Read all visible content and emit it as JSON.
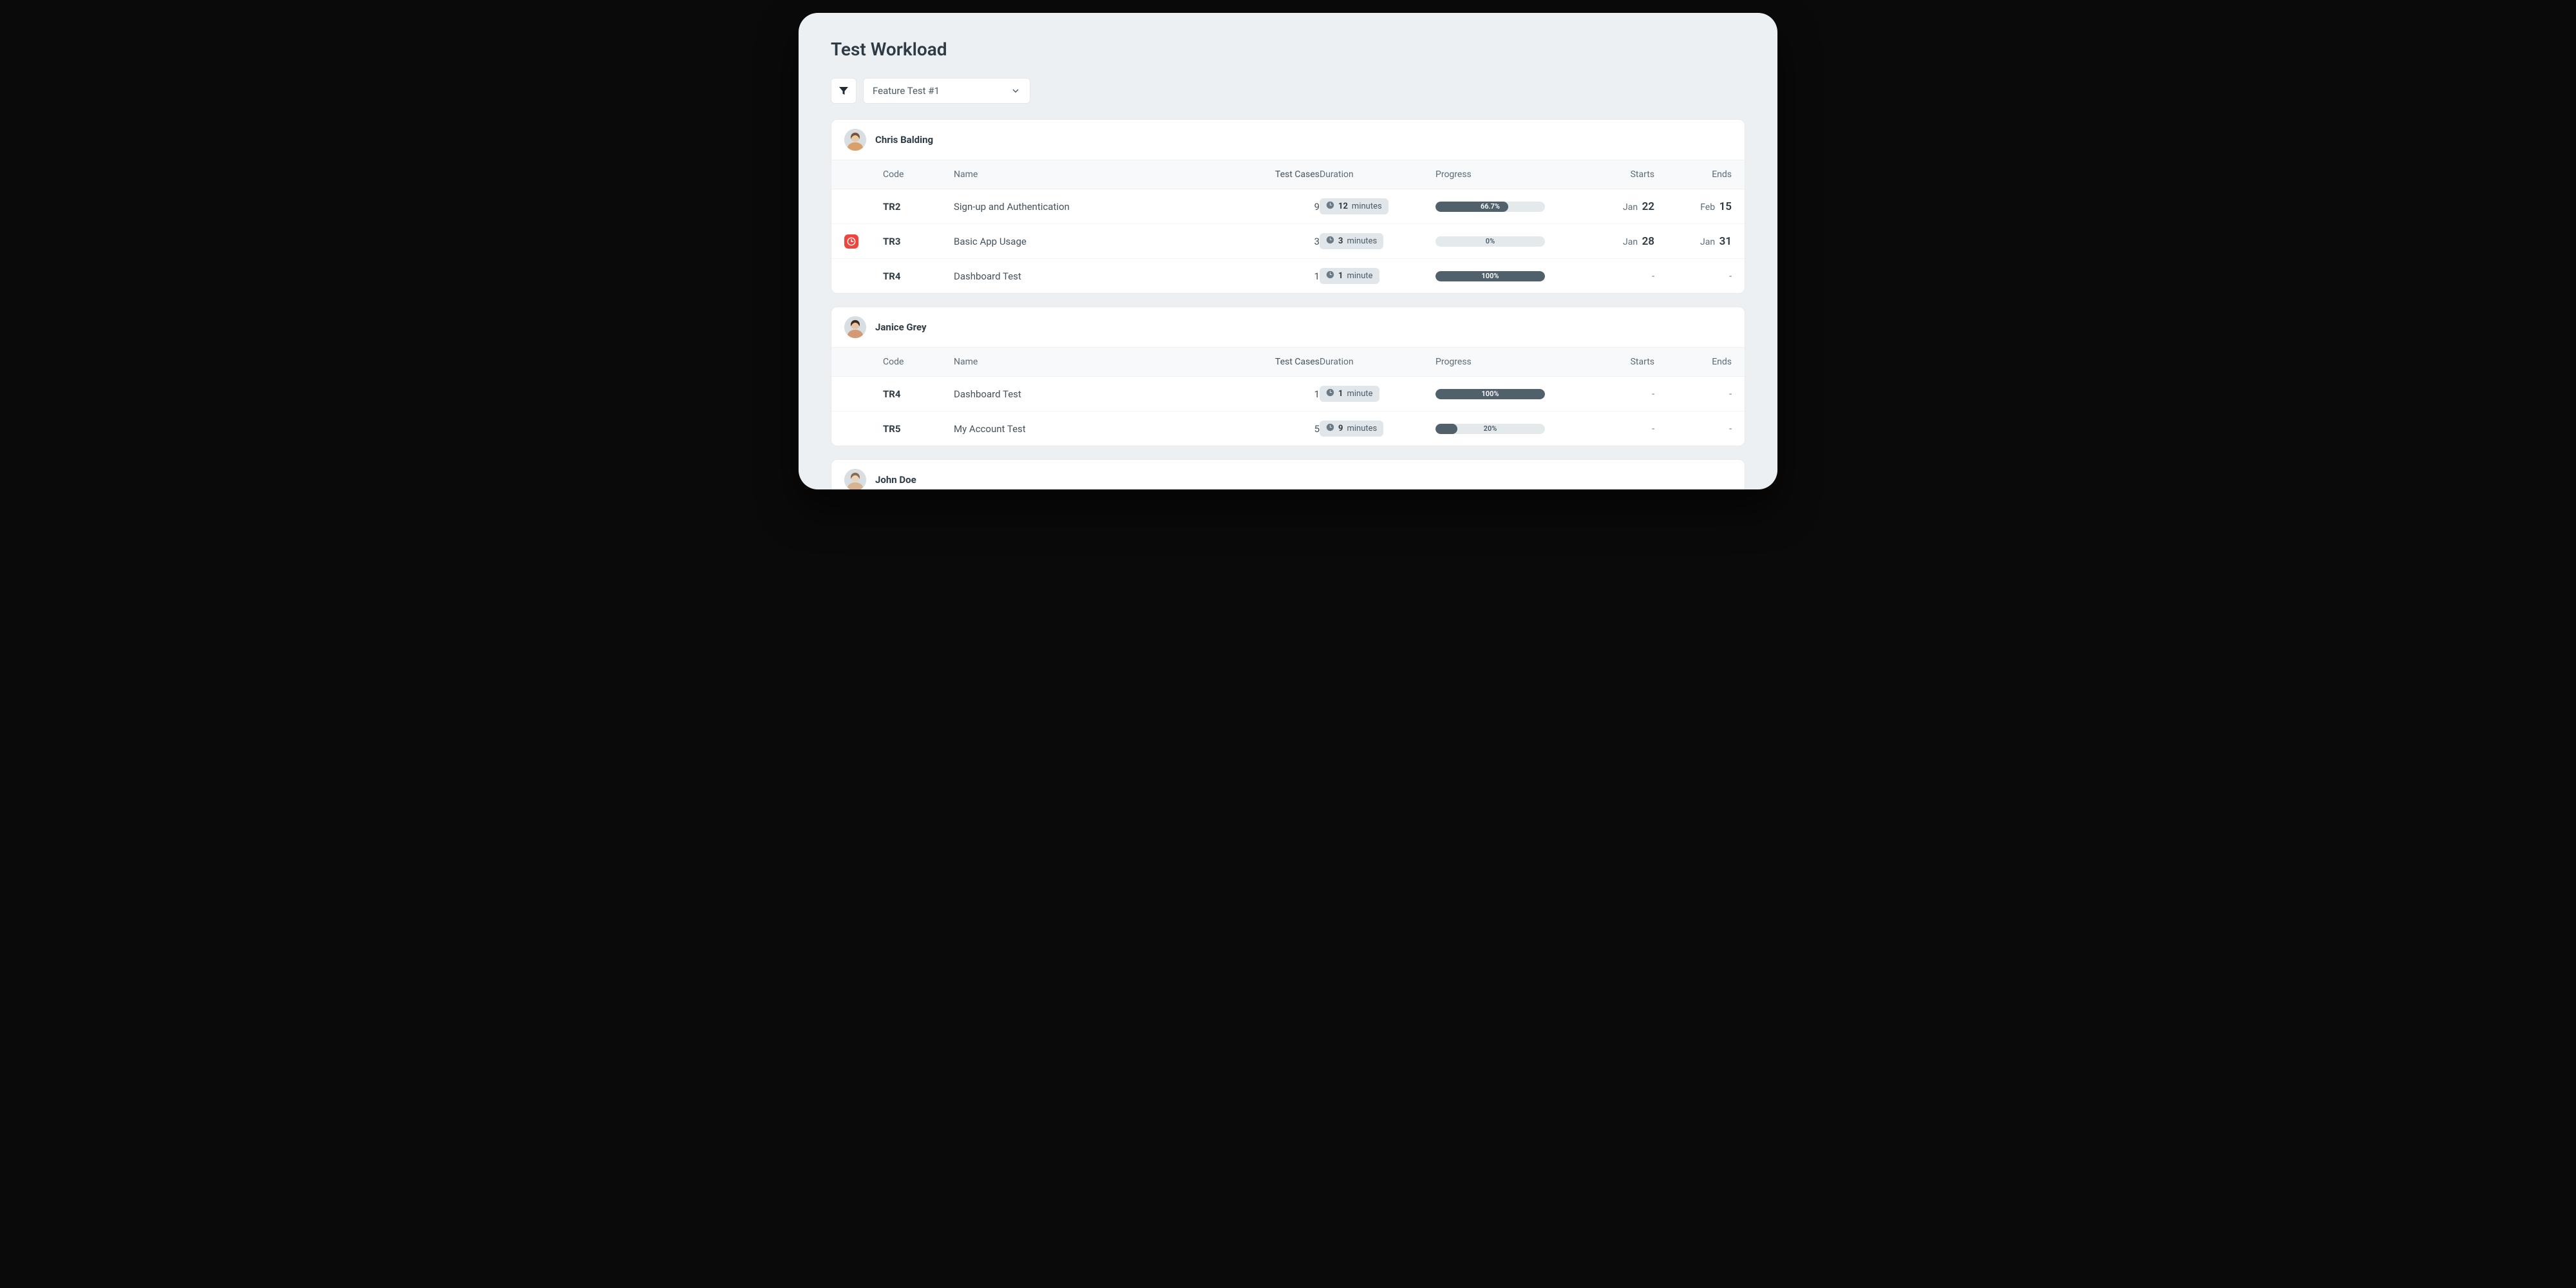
{
  "title": "Test Workload",
  "filter": {
    "selected": "Feature Test #1"
  },
  "columns": {
    "code": "Code",
    "name": "Name",
    "test_cases": "Test Cases",
    "duration": "Duration",
    "progress": "Progress",
    "starts": "Starts",
    "ends": "Ends"
  },
  "groups": [
    {
      "person": "Chris Balding",
      "rows": [
        {
          "overdue": false,
          "code": "TR2",
          "name": "Sign-up and Authentication",
          "test_cases": "9",
          "dur_num": "12",
          "dur_unit": "minutes",
          "progress_pct": 66.7,
          "progress_label": "66.7%",
          "start_mon": "Jan",
          "start_day": "22",
          "end_mon": "Feb",
          "end_day": "15"
        },
        {
          "overdue": true,
          "code": "TR3",
          "name": "Basic App Usage",
          "test_cases": "3",
          "dur_num": "3",
          "dur_unit": "minutes",
          "progress_pct": 0,
          "progress_label": "0%",
          "start_mon": "Jan",
          "start_day": "28",
          "end_mon": "Jan",
          "end_day": "31"
        },
        {
          "overdue": false,
          "code": "TR4",
          "name": "Dashboard Test",
          "test_cases": "1",
          "dur_num": "1",
          "dur_unit": "minute",
          "progress_pct": 100,
          "progress_label": "100%",
          "start_mon": "-",
          "start_day": "",
          "end_mon": "-",
          "end_day": ""
        }
      ]
    },
    {
      "person": "Janice Grey",
      "rows": [
        {
          "overdue": false,
          "code": "TR4",
          "name": "Dashboard Test",
          "test_cases": "1",
          "dur_num": "1",
          "dur_unit": "minute",
          "progress_pct": 100,
          "progress_label": "100%",
          "start_mon": "-",
          "start_day": "",
          "end_mon": "-",
          "end_day": ""
        },
        {
          "overdue": false,
          "code": "TR5",
          "name": "My Account Test",
          "test_cases": "5",
          "dur_num": "9",
          "dur_unit": "minutes",
          "progress_pct": 20,
          "progress_label": "20%",
          "start_mon": "-",
          "start_day": "",
          "end_mon": "-",
          "end_day": ""
        }
      ]
    },
    {
      "person": "John Doe",
      "rows": []
    }
  ]
}
